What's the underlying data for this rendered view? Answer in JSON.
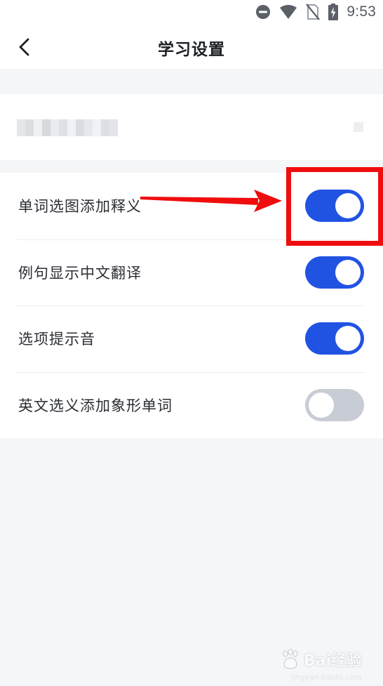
{
  "status_bar": {
    "time": "9:53",
    "icons": [
      "do-not-disturb-icon",
      "wifi-icon",
      "no-sim-icon",
      "battery-charging-icon"
    ]
  },
  "header": {
    "back_icon": "chevron-left-icon",
    "title": "学习设置"
  },
  "account": {
    "name_redacted": true
  },
  "settings": [
    {
      "label": "单词选图添加释义",
      "enabled": true
    },
    {
      "label": "例句显示中文翻译",
      "enabled": true
    },
    {
      "label": "选项提示音",
      "enabled": true
    },
    {
      "label": "英文选义添加象形单词",
      "enabled": false
    }
  ],
  "annotation": {
    "highlight_color": "#f00d0d",
    "target_setting_index": 0
  },
  "colors": {
    "toggle_on": "#2153e3",
    "toggle_off": "#c7ccd5",
    "page_background": "#f5f6f8"
  },
  "watermark": {
    "text": "Bai经验",
    "subtext": "jingyan.baidu.com"
  }
}
